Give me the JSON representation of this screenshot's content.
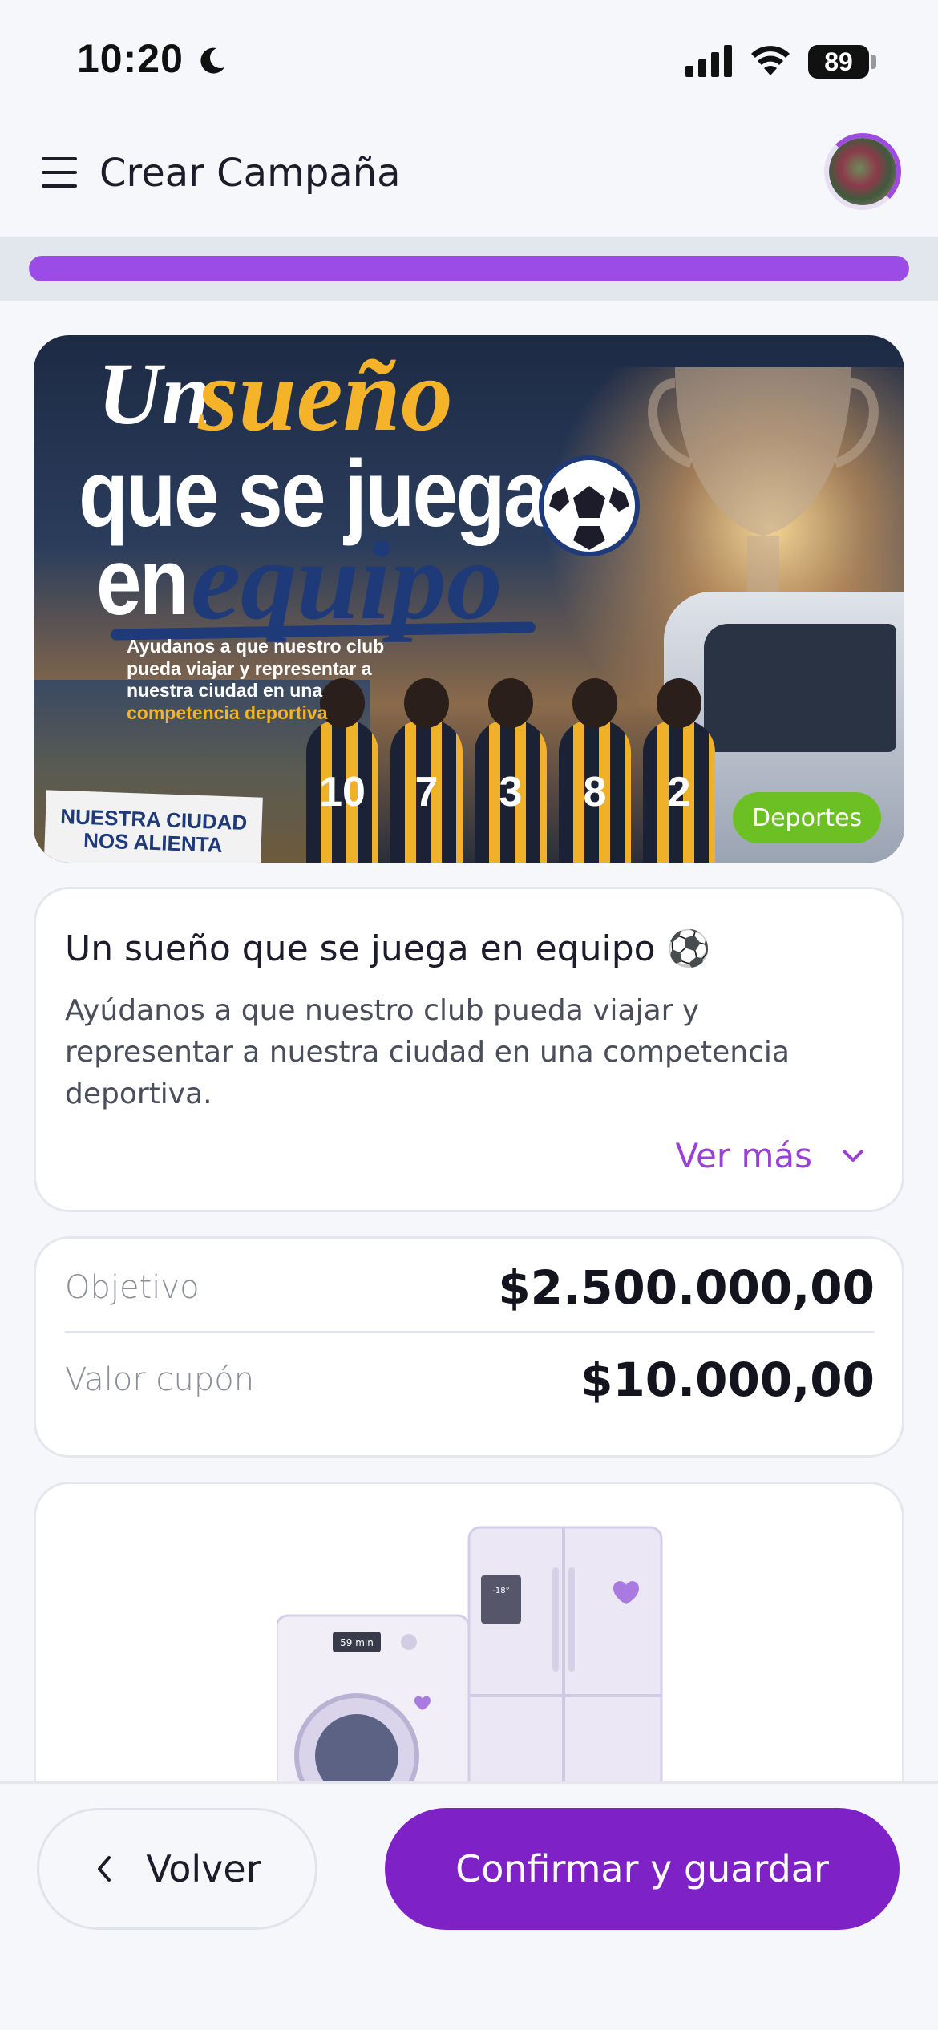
{
  "status_bar": {
    "time": "10:20",
    "battery": "89"
  },
  "header": {
    "title": "Crear Campaña"
  },
  "progress": {
    "value": 1.0
  },
  "banner": {
    "title_line1_a": "Un",
    "title_line1_b": "sueño",
    "title_line2": "que se juega",
    "title_line3_a": "en",
    "title_line3_b": "equipo",
    "subtitle": "Ayudanos a que nuestro club pueda viajar y representar a nuestra ciudad en una",
    "subtitle_accent": "competencia deportiva",
    "sign_text": "NUESTRA CIUDAD NOS ALIENTA",
    "jersey_numbers": [
      "10",
      "7",
      "3",
      "8",
      "2"
    ],
    "category": "Deportes"
  },
  "campaign": {
    "title": "Un sueño que se juega en equipo ⚽",
    "description": "Ayúdanos a que nuestro club pueda viajar y representar a nuestra ciudad en una competencia deportiva.",
    "more_label": "Ver más"
  },
  "goal": {
    "objective_label": "Objetivo",
    "objective_value": "$2.500.000,00",
    "coupon_label": "Valor cupón",
    "coupon_value": "$10.000,00"
  },
  "prize": {
    "washer_display": "59 min",
    "fridge_display": "-18°"
  },
  "actions": {
    "back_label": "Volver",
    "confirm_label": "Confirmar y guardar"
  },
  "colors": {
    "primary": "#7e22c8",
    "progress": "#9b4be6",
    "badge": "#6cc024",
    "link": "#9b3fd9"
  }
}
